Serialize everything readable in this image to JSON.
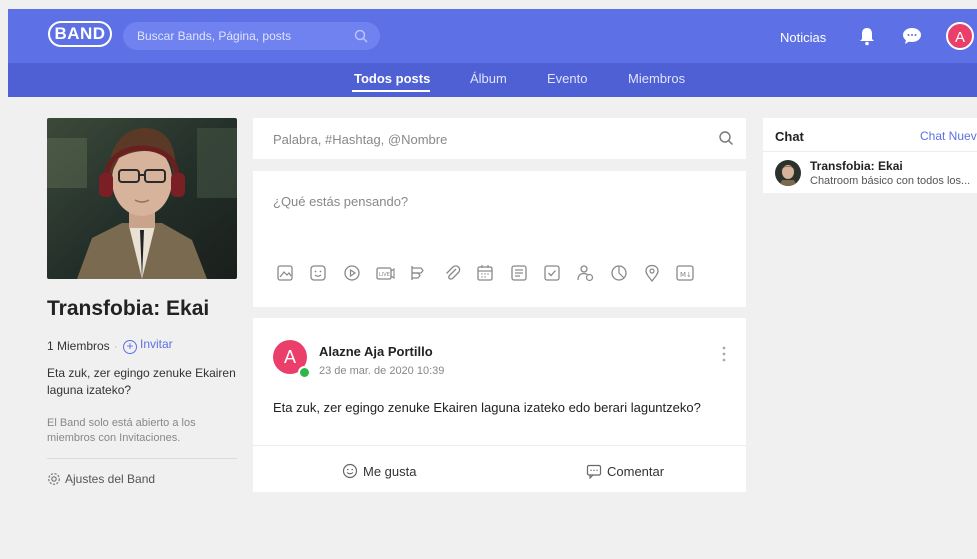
{
  "app": {
    "logo": "BAND"
  },
  "topbar": {
    "search_placeholder": "Buscar Bands, Página, posts",
    "news_label": "Noticias",
    "avatar_letter": "A"
  },
  "tabs": [
    {
      "label": "Todos posts",
      "active": true
    },
    {
      "label": "Álbum",
      "active": false
    },
    {
      "label": "Evento",
      "active": false
    },
    {
      "label": "Miembros",
      "active": false
    }
  ],
  "band": {
    "name": "Transfobia: Ekai",
    "members": "1 Miembros",
    "invite_label": "Invitar",
    "description": "Eta zuk, zer egingo zenuke Ekairen laguna izateko?",
    "note": "El Band solo está abierto a los miembros con Invitaciones.",
    "settings_label": "Ajustes del Band"
  },
  "post_search": {
    "placeholder": "Palabra, #Hashtag, @Nombre"
  },
  "compose": {
    "placeholder": "¿Qué estás pensando?",
    "tools": [
      "image-icon",
      "emoji-icon",
      "video-icon",
      "live-icon",
      "poll-icon",
      "attach-icon",
      "calendar-icon",
      "list-icon",
      "todo-icon",
      "people-icon",
      "chart-icon",
      "location-icon",
      "markdown-icon"
    ]
  },
  "post": {
    "avatar_letter": "A",
    "author": "Alazne Aja Portillo",
    "time": "23 de mar. de 2020 10:39",
    "body": "Eta zuk, zer egingo zenuke Ekairen laguna izateko edo berari laguntzeko?",
    "like_label": "Me gusta",
    "comment_label": "Comentar"
  },
  "chat": {
    "title": "Chat",
    "new_label": "Chat Nuevo",
    "room_name": "Transfobia: Ekai",
    "room_preview": "Chatroom básico con todos los..."
  },
  "colors": {
    "brand": "#5d70e5",
    "brand_dark": "#4e60d4",
    "avatar": "#ea3f6a",
    "online": "#2db84d"
  }
}
